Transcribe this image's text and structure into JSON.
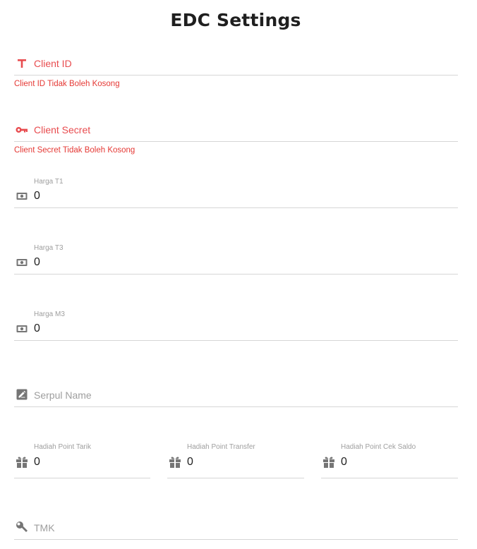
{
  "title": "EDC Settings",
  "colors": {
    "error": "#e84c4f",
    "icon": "#757575",
    "divider": "#d6d6d6",
    "muted": "#9e9e9e"
  },
  "fields": {
    "client_id": {
      "label": "Client ID",
      "error": "Client ID Tidak Boleh Kosong",
      "icon": "text-t-icon"
    },
    "client_secret": {
      "label": "Client Secret",
      "error": "Client Secret Tidak Boleh Kosong",
      "icon": "key-icon"
    },
    "harga_t1": {
      "label": "Harga T1",
      "value": "0",
      "icon": "money-icon"
    },
    "harga_t3": {
      "label": "Harga T3",
      "value": "0",
      "icon": "money-icon"
    },
    "harga_m3": {
      "label": "Harga M3",
      "value": "0",
      "icon": "money-icon"
    },
    "serpul_name": {
      "placeholder": "Serpul Name",
      "icon": "edit-icon"
    },
    "hadiah_point_tarik": {
      "label": "Hadiah Point Tarik",
      "value": "0",
      "icon": "gift-icon"
    },
    "hadiah_point_transfer": {
      "label": "Hadiah Point Transfer",
      "value": "0",
      "icon": "gift-icon"
    },
    "hadiah_point_cek_saldo": {
      "label": "Hadiah Point Cek Saldo",
      "value": "0",
      "icon": "gift-icon"
    },
    "tmk": {
      "placeholder": "TMK",
      "icon": "wrench-icon"
    }
  }
}
